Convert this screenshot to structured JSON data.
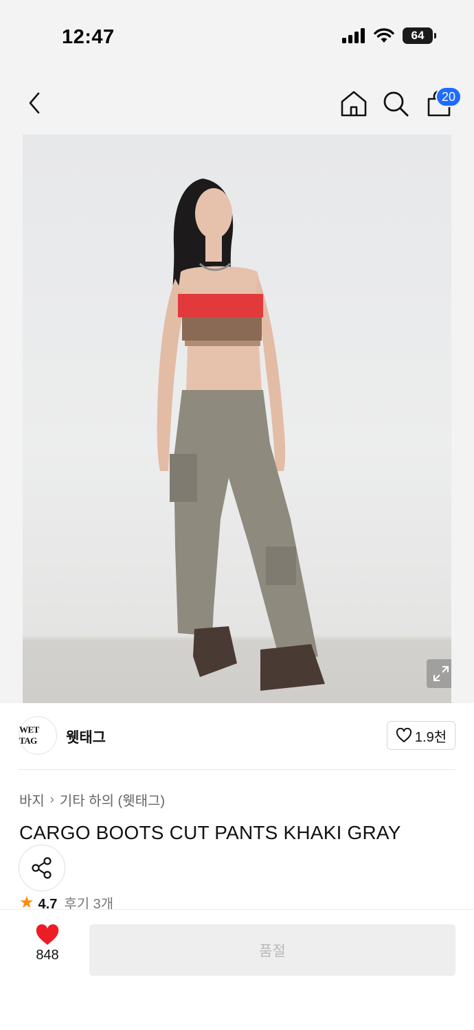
{
  "status_bar": {
    "time": "12:47",
    "battery": "64"
  },
  "nav": {
    "cart_count": "20"
  },
  "brand": {
    "logo_text": "WET TAG",
    "name": "웻태그",
    "likes": "1.9천"
  },
  "product": {
    "breadcrumb": [
      "바지",
      "기타 하의 (웻태그)"
    ],
    "title": "CARGO BOOTS CUT PANTS KHAKI GRAY",
    "rating": "4.7",
    "review_label": "후기 3개"
  },
  "bottom_bar": {
    "wish_count": "848",
    "soldout_label": "품절"
  },
  "colors": {
    "badge_blue": "#1f6bff",
    "star_orange": "#ff8a00",
    "heart_red": "#ee1c25"
  }
}
